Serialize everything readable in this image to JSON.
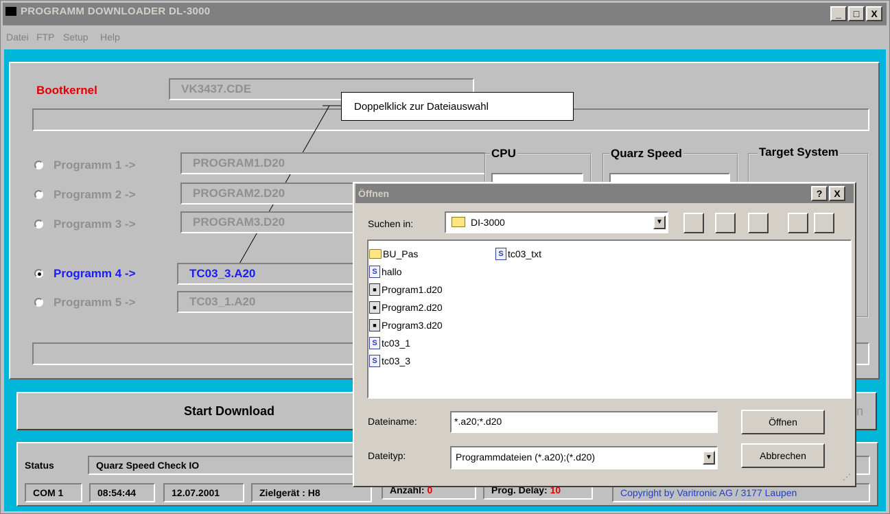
{
  "window": {
    "title": "PROGRAMM DOWNLOADER DL-3000",
    "controls": {
      "minimize": "_",
      "maximize": "□",
      "close": "X"
    }
  },
  "menubar": {
    "items": [
      "Datei",
      "FTP",
      "Setup",
      "Help"
    ]
  },
  "bootkernel": {
    "label": "Bootkernel",
    "file": "VK3437.CDE"
  },
  "callout": {
    "text": "Doppelklick zur Dateiauswahl"
  },
  "programs": [
    {
      "label": "Programm 1 ->",
      "file": "PROGRAM1.D20",
      "selected": false
    },
    {
      "label": "Programm 2 ->",
      "file": "PROGRAM2.D20",
      "selected": false
    },
    {
      "label": "Programm 3 ->",
      "file": "PROGRAM3.D20",
      "selected": false
    },
    {
      "label": "Programm 4 ->",
      "file": "TC03_3.A20",
      "selected": true
    },
    {
      "label": "Programm 5 ->",
      "file": "TC03_1.A20",
      "selected": false
    }
  ],
  "groups": {
    "cpu": "CPU",
    "quarz": "Quarz Speed",
    "target": "Target System"
  },
  "buttons": {
    "start_download": "Start Download",
    "right_partial": "n"
  },
  "status": {
    "label": "Status",
    "text": "Quarz Speed Check IO",
    "com": "COM 1",
    "time": "08:54:44",
    "date": "12.07.2001",
    "zielgeraet": "Zielgerät : H8",
    "anzahl_label": "Anzahl:",
    "anzahl_value": "0",
    "delay_label": "Prog. Delay:",
    "delay_value": "10",
    "copyright": "Copyright by Varitronic AG / 3177 Laupen"
  },
  "dialog": {
    "title": "Öffnen",
    "help": "?",
    "close": "X",
    "lookin_label": "Suchen in:",
    "lookin_value": "DI-3000",
    "files": [
      {
        "name": "BU_Pas",
        "icon": "folder-icon"
      },
      {
        "name": "hallo",
        "icon": "script-icon"
      },
      {
        "name": "Program1.d20",
        "icon": "program-file-icon"
      },
      {
        "name": "Program2.d20",
        "icon": "program-file-icon"
      },
      {
        "name": "Program3.d20",
        "icon": "program-file-icon"
      },
      {
        "name": "tc03_1",
        "icon": "script-icon"
      },
      {
        "name": "tc03_3",
        "icon": "script-icon"
      },
      {
        "name": "tc03_txt",
        "icon": "script-icon"
      }
    ],
    "filename_label": "Dateiname:",
    "filename_value": "*.a20;*.d20",
    "filetype_label": "Dateityp:",
    "filetype_value": "Programmdateien  (*.a20);(*.d20)",
    "open_button": "Öffnen",
    "cancel_button": "Abbrechen"
  },
  "colors": {
    "client": "#00b6d8",
    "bootkernel": "#e00000",
    "selected": "#1a1aff",
    "counter": "#e00000",
    "copyright": "#2040c0"
  }
}
